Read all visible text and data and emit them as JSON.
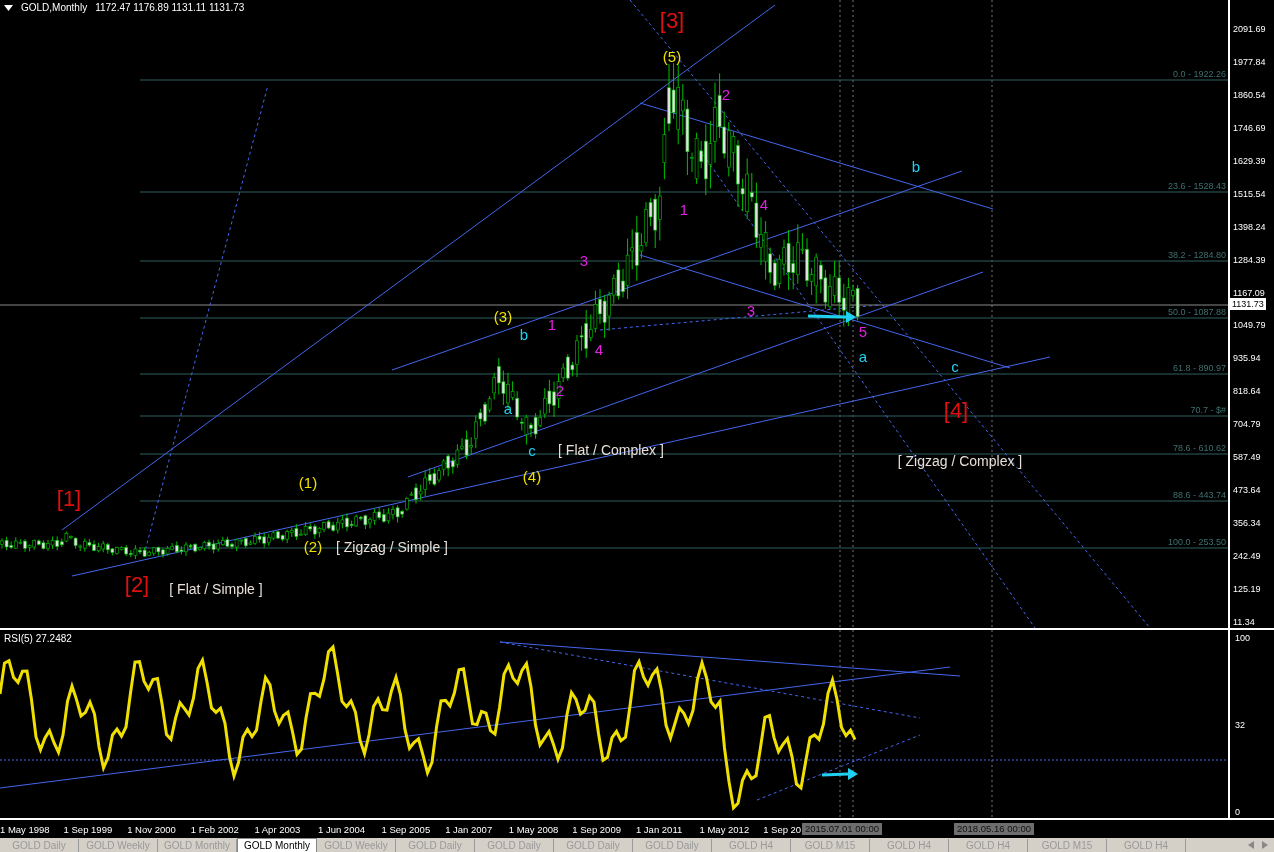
{
  "chart_header": {
    "symbol": "GOLD,Monthly",
    "ohlc": "1172.47 1176.89 1131.11 1131.73"
  },
  "price_axis": {
    "ticks": [
      "2091.69",
      "1977.84",
      "1860.54",
      "1746.69",
      "1629.39",
      "1515.54",
      "1398.24",
      "1284.39",
      "1167.09",
      "1049.79",
      "935.94",
      "818.64",
      "704.79",
      "587.49",
      "473.64",
      "356.34",
      "242.49",
      "125.19",
      "11.34"
    ],
    "current_price": "1131.73"
  },
  "fib_levels": [
    {
      "label": "0.0 - 1922.26"
    },
    {
      "label": "23.6  - 1528.43"
    },
    {
      "label": "38.2 - 1284.80"
    },
    {
      "label": "50.0 - 1087.88"
    },
    {
      "label": "61.8 - 890.97"
    },
    {
      "label": "70.7 - $#"
    },
    {
      "label": "78.6 - 610.62"
    },
    {
      "label": "88.6 - 443.74"
    },
    {
      "label": "100.0 - 253.50"
    }
  ],
  "wave_labels": [
    {
      "text": "[3]",
      "color": "#e01010"
    },
    {
      "text": "(5)",
      "color": "#f0e000"
    },
    {
      "text": "2",
      "color": "#e020e0"
    },
    {
      "text": "b",
      "color": "#20d0f0"
    },
    {
      "text": "4",
      "color": "#e020e0"
    },
    {
      "text": "1",
      "color": "#e020e0"
    },
    {
      "text": "3",
      "color": "#e020e0"
    },
    {
      "text": "(3)",
      "color": "#f0e000"
    },
    {
      "text": "b",
      "color": "#20d0f0"
    },
    {
      "text": "1",
      "color": "#e020e0"
    },
    {
      "text": "3",
      "color": "#e020e0"
    },
    {
      "text": "5",
      "color": "#e020e0"
    },
    {
      "text": "4",
      "color": "#e020e0"
    },
    {
      "text": "a",
      "color": "#20d0f0"
    },
    {
      "text": "c",
      "color": "#20d0f0"
    },
    {
      "text": "2",
      "color": "#e020e0"
    },
    {
      "text": "a",
      "color": "#20d0f0"
    },
    {
      "text": "[4]",
      "color": "#e01010"
    },
    {
      "text": "c",
      "color": "#20d0f0"
    },
    {
      "text": "[ Flat / Complex ]",
      "color": "#e8e0d8"
    },
    {
      "text": "(4)",
      "color": "#f0e000"
    },
    {
      "text": "[ Zigzag / Complex ]",
      "color": "#e8e0d8"
    },
    {
      "text": "(1)",
      "color": "#f0e000"
    },
    {
      "text": "[1]",
      "color": "#e01010"
    },
    {
      "text": "(2)",
      "color": "#f0e000"
    },
    {
      "text": "[ Zigzag / Simple ]",
      "color": "#e8e0d8"
    },
    {
      "text": "[2]",
      "color": "#e01010"
    },
    {
      "text": "[ Flat / Simple ]",
      "color": "#e8e0d8"
    }
  ],
  "rsi": {
    "title": "RSI(5) 27.2482",
    "ticks": [
      "100",
      "32",
      "0"
    ]
  },
  "time_axis": {
    "ticks": [
      "1 May 1998",
      "1 Sep 1999",
      "1 Nov 2000",
      "1 Feb 2002",
      "1 Apr 2003",
      "1 Jun 2004",
      "1 Sep 2005",
      "1 Jan 2007",
      "1 May 2008",
      "1 Sep 2009",
      "1 Jan 2011",
      "1 May 2012",
      "1 Sep 20"
    ],
    "markers": [
      "2015.07.01 00:00",
      "2018.05.16 00:00"
    ]
  },
  "tabs": [
    {
      "label": "GOLD Daily",
      "selected": false
    },
    {
      "label": "GOLD Weekly",
      "selected": false
    },
    {
      "label": "GOLD Monthly",
      "selected": false
    },
    {
      "label": "GOLD Monthly",
      "selected": true
    },
    {
      "label": "GOLD Weekly",
      "selected": false
    },
    {
      "label": "GOLD Daily",
      "selected": false
    },
    {
      "label": "GOLD Daily",
      "selected": false
    },
    {
      "label": "GOLD Daily",
      "selected": false
    },
    {
      "label": "GOLD Daily",
      "selected": false
    },
    {
      "label": "GOLD H4",
      "selected": false
    },
    {
      "label": "GOLD M15",
      "selected": false
    },
    {
      "label": "GOLD H4",
      "selected": false
    },
    {
      "label": "GOLD H4",
      "selected": false
    },
    {
      "label": "GOLD M15",
      "selected": false
    },
    {
      "label": "GOLD H4",
      "selected": false
    }
  ]
}
